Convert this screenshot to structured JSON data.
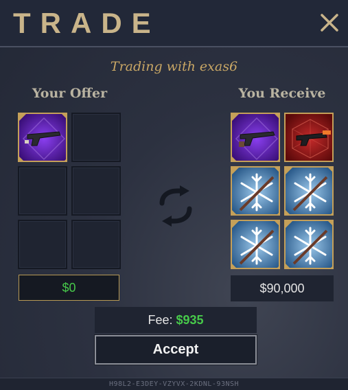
{
  "header": {
    "title": "TRADE",
    "close_icon": "close-icon"
  },
  "subtitle": "Trading with exas6",
  "your_offer": {
    "heading": "Your Offer",
    "slots": [
      {
        "item": "purple-revolver-item"
      },
      {
        "item": null
      },
      {
        "item": null
      },
      {
        "item": null
      },
      {
        "item": null
      },
      {
        "item": null
      }
    ],
    "money": "$0"
  },
  "you_receive": {
    "heading": "You Receive",
    "slots": [
      {
        "item": "purple-revolver-item"
      },
      {
        "item": "red-pistol-item"
      },
      {
        "item": "snowflake-rifle-item"
      },
      {
        "item": "snowflake-rifle-item"
      },
      {
        "item": "snowflake-rifle-item"
      },
      {
        "item": "snowflake-rifle-item"
      }
    ],
    "money": "$90,000"
  },
  "fee": {
    "label": "Fee:",
    "value": "$935"
  },
  "accept_label": "Accept",
  "footer_code": "H98L2-E3DEY-VZYVX-2KDNL-93NSH",
  "colors": {
    "gold": "#c9b48a",
    "green": "#47c94a",
    "purple": "#5b1fa8",
    "red": "#9c1a1a",
    "ice": "#4a7fb0"
  }
}
